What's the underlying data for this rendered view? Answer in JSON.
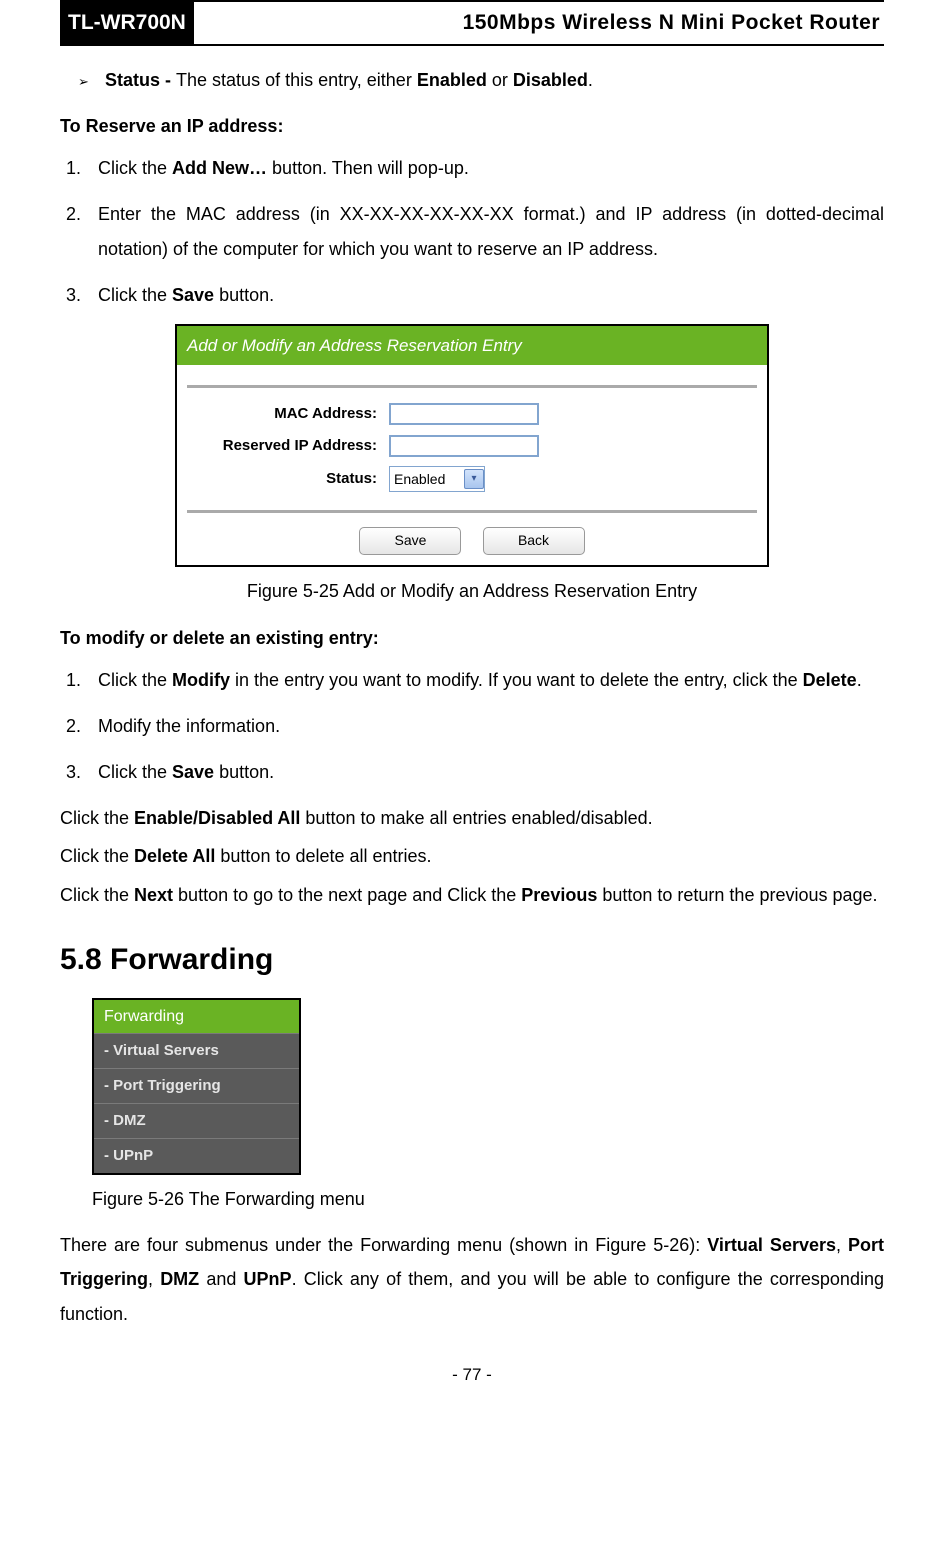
{
  "header": {
    "model": "TL-WR700N",
    "title": "150Mbps Wireless N Mini Pocket Router"
  },
  "bullet": {
    "label": "Status - ",
    "text_a": "The status of this entry, either ",
    "bold_a": "Enabled",
    "text_b": " or ",
    "bold_b": "Disabled",
    "text_c": "."
  },
  "reserve_heading": "To Reserve an IP address:",
  "reserve_steps": {
    "s1_a": "Click the ",
    "s1_b": "Add New…",
    "s1_c": " button. Then will pop-up.",
    "s2": "Enter the MAC address (in XX-XX-XX-XX-XX-XX format.) and IP address (in dotted-decimal notation) of the computer for which you want to reserve an IP address.",
    "s3_a": "Click the ",
    "s3_b": "Save",
    "s3_c": " button."
  },
  "dialog": {
    "title": "Add or Modify an Address Reservation Entry",
    "mac_label": "MAC Address:",
    "ip_label": "Reserved IP Address:",
    "status_label": "Status:",
    "status_value": "Enabled",
    "save_btn": "Save",
    "back_btn": "Back"
  },
  "fig1_caption": "Figure 5-25 Add or Modify an Address Reservation Entry",
  "modify_heading": "To modify or delete an existing entry:",
  "modify_steps": {
    "s1_a": "Click the ",
    "s1_b": "Modify",
    "s1_c": " in the entry you want to modify. If you want to delete the entry, click the ",
    "s1_d": "Delete",
    "s1_e": ".",
    "s2": "Modify the information.",
    "s3_a": "Click the ",
    "s3_b": "Save",
    "s3_c": " button."
  },
  "plain": {
    "p1_a": "Click the ",
    "p1_b": "Enable/Disabled All",
    "p1_c": " button to make all entries enabled/disabled.",
    "p2_a": "Click the ",
    "p2_b": "Delete All",
    "p2_c": " button to delete all entries.",
    "p3_a": "Click the ",
    "p3_b": "Next",
    "p3_c": " button to go to the next page and Click the ",
    "p3_d": "Previous",
    "p3_e": " button to return the previous page."
  },
  "section58": "5.8  Forwarding",
  "menu": {
    "head": "Forwarding",
    "items": [
      "- Virtual Servers",
      "- Port Triggering",
      "- DMZ",
      "- UPnP"
    ]
  },
  "fig2_caption": "Figure 5-26 The Forwarding menu",
  "forwarding_para": {
    "a": "There are four submenus under the Forwarding menu (shown in Figure 5-26): ",
    "b": "Virtual Servers",
    "c": ", ",
    "d": "Port Triggering",
    "e": ", ",
    "f": "DMZ",
    "g": " and ",
    "h": "UPnP",
    "i": ". Click any of them, and you will be able to configure the corresponding function."
  },
  "page_num": "- 77 -"
}
